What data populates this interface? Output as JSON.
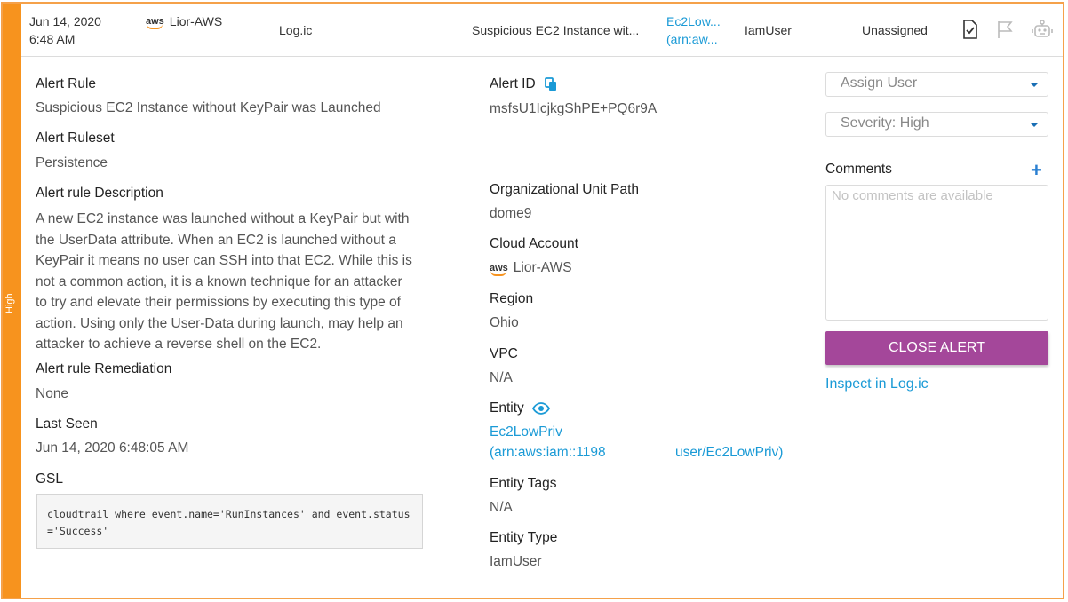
{
  "severity_bar": {
    "label": "High",
    "color": "#f7931e"
  },
  "header": {
    "date": "Jun 14, 2020",
    "time": "6:48 AM",
    "aws_logo": "aws",
    "account": "Lior-AWS",
    "organization": "Log.ic",
    "rule": "Suspicious EC2 Instance wit...",
    "entity_line1": "Ec2Low...",
    "entity_line2": "(arn:aw...",
    "entity_type": "IamUser",
    "assignee": "Unassigned",
    "icons": [
      "check-document-icon",
      "flag-icon",
      "robot-icon"
    ]
  },
  "details_left": {
    "alert_rule_label": "Alert Rule",
    "alert_rule_value": "Suspicious EC2 Instance without KeyPair was Launched",
    "ruleset_label": "Alert Ruleset",
    "ruleset_value": "Persistence",
    "description_label": "Alert rule Description",
    "description_lines": [
      "A new EC2 instance was launched without a KeyPair but with",
      "the UserData attribute. When an EC2 is launched without a",
      "KeyPair it means no user can SSH into that EC2. While this is",
      "not a common action, it is a known technique for an attacker",
      "to try and elevate their permissions by executing this type of",
      "action. Using only the User-Data during launch, may help an",
      "attacker to achieve a reverse shell on the EC2."
    ],
    "remediation_label": "Alert rule Remediation",
    "remediation_value": "None",
    "last_seen_label": "Last Seen",
    "last_seen_value": "Jun 14, 2020 6:48:05 AM",
    "gsl_label": "GSL",
    "gsl_value": "cloudtrail where event.name='RunInstances' and event.status='Success'"
  },
  "details_mid": {
    "alert_id_label": "Alert ID",
    "alert_id_value": "msfsU1IcjkgShPE+PQ6r9A",
    "ou_path_label": "Organizational Unit Path",
    "ou_path_value": "dome9",
    "cloud_account_label": "Cloud Account",
    "cloud_account_logo": "aws",
    "cloud_account_value": "Lior-AWS",
    "region_label": "Region",
    "region_value": "Ohio",
    "vpc_label": "VPC",
    "vpc_value": "N/A",
    "entity_label": "Entity",
    "entity_line1": "Ec2LowPriv",
    "entity_arn": "(arn:aws:iam::1198",
    "entity_arn_tail": "user/Ec2LowPriv)",
    "entity_tags_label": "Entity Tags",
    "entity_tags_value": "N/A",
    "entity_type_label": "Entity Type",
    "entity_type_value": "IamUser"
  },
  "side_panel": {
    "assign_user": "Assign User",
    "severity": "Severity: High",
    "comments_label": "Comments",
    "add_symbol": "+",
    "comments_placeholder": "No comments are available",
    "close_button": "CLOSE ALERT",
    "inspect_link": "Inspect in Log.ic"
  },
  "colors": {
    "accent_purple": "#a4479a",
    "link_blue": "#1a9ad6",
    "severity_orange": "#f7931e"
  }
}
